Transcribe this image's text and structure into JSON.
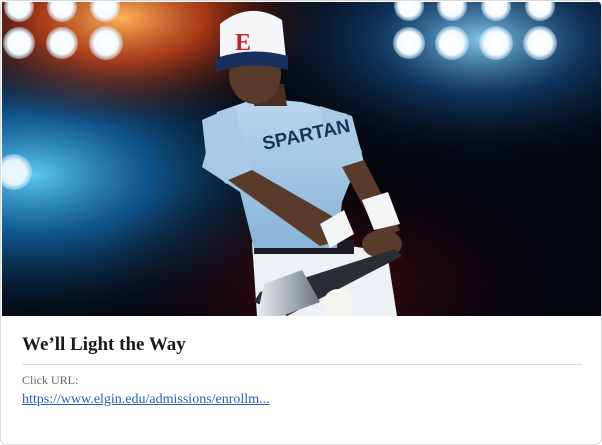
{
  "card": {
    "title": "We’ll Light the Way",
    "url_label": "Click URL:",
    "url_text": "https://www.elgin.edu/admissions/enrollm...",
    "link_color": "#1f5fbf"
  },
  "hero_image": {
    "cap_letter": "E",
    "jersey_text": "SPARTAN"
  }
}
